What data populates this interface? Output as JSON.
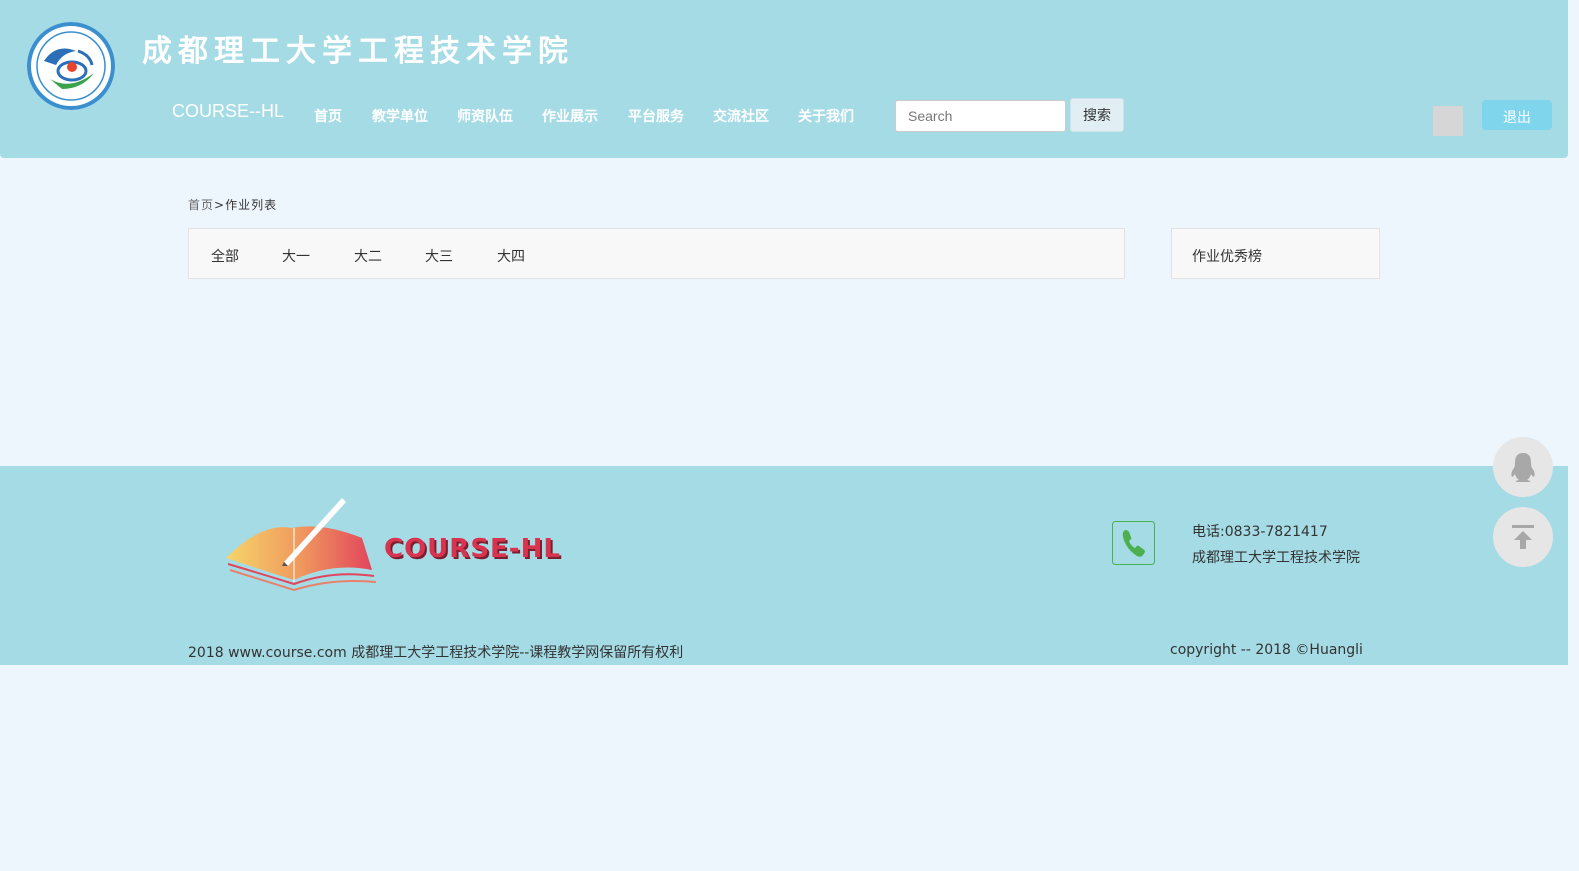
{
  "header": {
    "school_name": "成都理工大学工程技术学院",
    "brand": "COURSE--HL",
    "nav": [
      "首页",
      "教学单位",
      "师资队伍",
      "作业展示",
      "平台服务",
      "交流社区",
      "关于我们"
    ],
    "search_placeholder": "Search",
    "search_button": "搜索",
    "logout_button": "退出"
  },
  "breadcrumb": {
    "home": "首页",
    "separator": ">",
    "current": "作业列表"
  },
  "tabs": [
    "全部",
    "大一",
    "大二",
    "大三",
    "大四"
  ],
  "sidebar": {
    "title": "作业优秀榜"
  },
  "footer": {
    "logo_text": "COURSE-HL",
    "phone": "电话:0833-7821417",
    "school": "成都理工大学工程技术学院",
    "copyright_left": "2018 www.course.com 成都理工大学工程技术学院--课程教学网保留所有权利",
    "copyright_right": "copyright -- 2018 ©Huangli"
  },
  "floating": {
    "qq_icon": "qq-penguin-icon",
    "top_icon": "back-to-top-icon"
  },
  "colors": {
    "header_bg": "#a5dbe5",
    "page_bg": "#eef6fd",
    "logout_bg": "#7fd5ec",
    "logo_text": "#d9344f"
  }
}
